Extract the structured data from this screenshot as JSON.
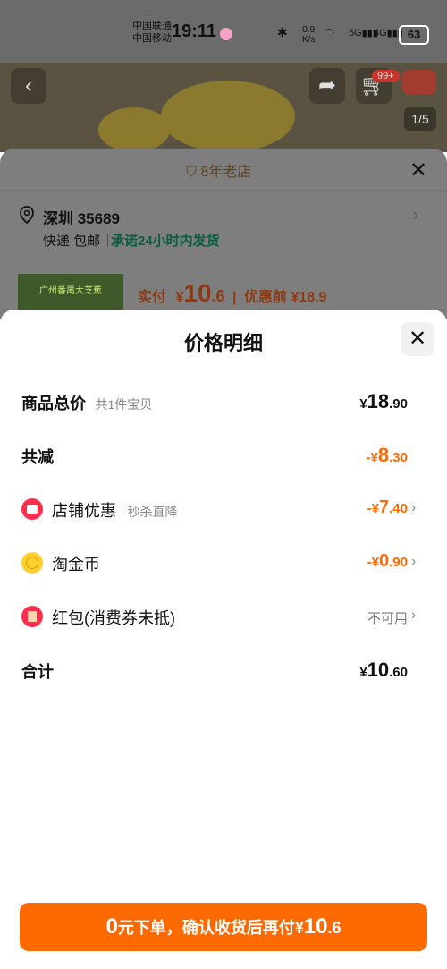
{
  "status_bar": {
    "carrier1": "中国联通",
    "carrier2": "中国移动",
    "time": "19:11",
    "speed_top": "0.9",
    "speed_bottom": "K/s",
    "battery": "63"
  },
  "product_header": {
    "cart_badge": "99+",
    "pager": "1/5"
  },
  "shipping_sheet": {
    "shop_badge": "8年老店",
    "city": "深圳 35689",
    "delivery": "快递 包邮",
    "promise": "承诺24小时内发货",
    "thumb_text": "广州番禺大芝蕉",
    "paid_label": "实付",
    "paid_currency": "¥",
    "paid_int": "10",
    "paid_dec": ".6",
    "before_label": "优惠前",
    "before_price": "¥18.9"
  },
  "price_detail": {
    "title": "价格明细",
    "rows": [
      {
        "label": "商品总价",
        "sub": "共1件宝贝",
        "currency": "¥",
        "int": "18",
        "dec": ".90"
      },
      {
        "label": "共减",
        "currency": "-¥",
        "int": "8",
        "dec": ".30"
      },
      {
        "label": "店铺优惠",
        "sub": "秒杀直降",
        "currency": "-¥",
        "int": "7",
        "dec": ".40"
      },
      {
        "label": "淘金币",
        "currency": "-¥",
        "int": "0",
        "dec": ".90"
      },
      {
        "label": "红包(消费券未抵)",
        "status": "不可用"
      },
      {
        "label": "合计",
        "currency": "¥",
        "int": "10",
        "dec": ".60"
      }
    ]
  },
  "order_button": {
    "num": "0",
    "text": "元下单，确认收货后再付",
    "currency": "¥",
    "int": "10",
    "dec": ".6"
  },
  "colors": {
    "accent": "#ff6a00",
    "icon_red": "#ff2e4d",
    "coin_yellow": "#ffcf2e"
  }
}
